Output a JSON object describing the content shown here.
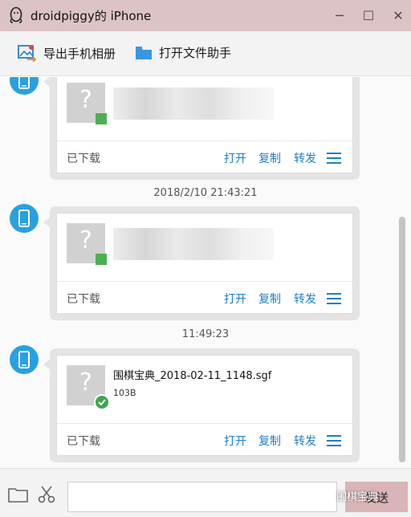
{
  "window": {
    "title": "droidpiggy的 iPhone",
    "controls": {
      "minimize": "─",
      "maximize": "☐",
      "close": "✕"
    }
  },
  "toolbar": {
    "export_label": "导出手机相册",
    "helper_label": "打开文件助手"
  },
  "messages": [
    {
      "timestamp": "",
      "file_name": "",
      "file_size": "",
      "status": "已下载",
      "actions": {
        "open": "打开",
        "copy": "复制",
        "forward": "转发"
      },
      "blurred": true
    },
    {
      "timestamp": "2018/2/10 21:43:21",
      "file_name": "",
      "file_size": "",
      "status": "已下载",
      "actions": {
        "open": "打开",
        "copy": "复制",
        "forward": "转发"
      },
      "blurred": true
    },
    {
      "timestamp": "11:49:23",
      "file_name": "围棋宝典_2018-02-11_1148.sgf",
      "file_size": "103B",
      "status": "已下载",
      "actions": {
        "open": "打开",
        "copy": "复制",
        "forward": "转发"
      },
      "blurred": false
    }
  ],
  "thumbnail_glyph": "?",
  "input": {
    "value": "",
    "placeholder": ""
  },
  "send_label": "发送",
  "watermark": "围棋宝典",
  "colors": {
    "titlebar": "#dcc3c6",
    "avatar": "#2aa0e0",
    "action_link": "#1f7ec8",
    "send_button": "#d9b5b8",
    "success": "#3aa84d"
  },
  "icons": {
    "title": "qq-penguin-icon",
    "export": "photo-export-icon",
    "helper": "folder-icon",
    "avatar": "phone-icon",
    "status": "check-icon",
    "menu": "hamburger-menu-icon",
    "folder": "folder-outline-icon",
    "scissors": "scissors-icon"
  }
}
